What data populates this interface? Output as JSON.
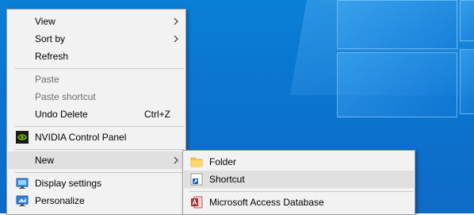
{
  "context_menu": {
    "items": [
      {
        "label": "View",
        "has_submenu": true
      },
      {
        "label": "Sort by",
        "has_submenu": true
      },
      {
        "label": "Refresh"
      },
      {
        "label": "Paste",
        "disabled": true
      },
      {
        "label": "Paste shortcut",
        "disabled": true
      },
      {
        "label": "Undo Delete",
        "shortcut": "Ctrl+Z"
      },
      {
        "label": "NVIDIA Control Panel",
        "icon": "nvidia-icon"
      },
      {
        "label": "New",
        "has_submenu": true,
        "highlighted": true
      },
      {
        "label": "Display settings",
        "icon": "display-icon"
      },
      {
        "label": "Personalize",
        "icon": "personalize-icon"
      }
    ]
  },
  "new_submenu": {
    "items": [
      {
        "label": "Folder",
        "icon": "folder-icon"
      },
      {
        "label": "Shortcut",
        "icon": "shortcut-icon"
      },
      {
        "label": "Microsoft Access Database",
        "icon": "access-icon"
      }
    ]
  },
  "colors": {
    "menu_bg": "#f2f2f2",
    "hover_bg": "#e0e0e0",
    "desktop_blue": "#0a74cf",
    "disabled_text": "#6d6d6d"
  }
}
